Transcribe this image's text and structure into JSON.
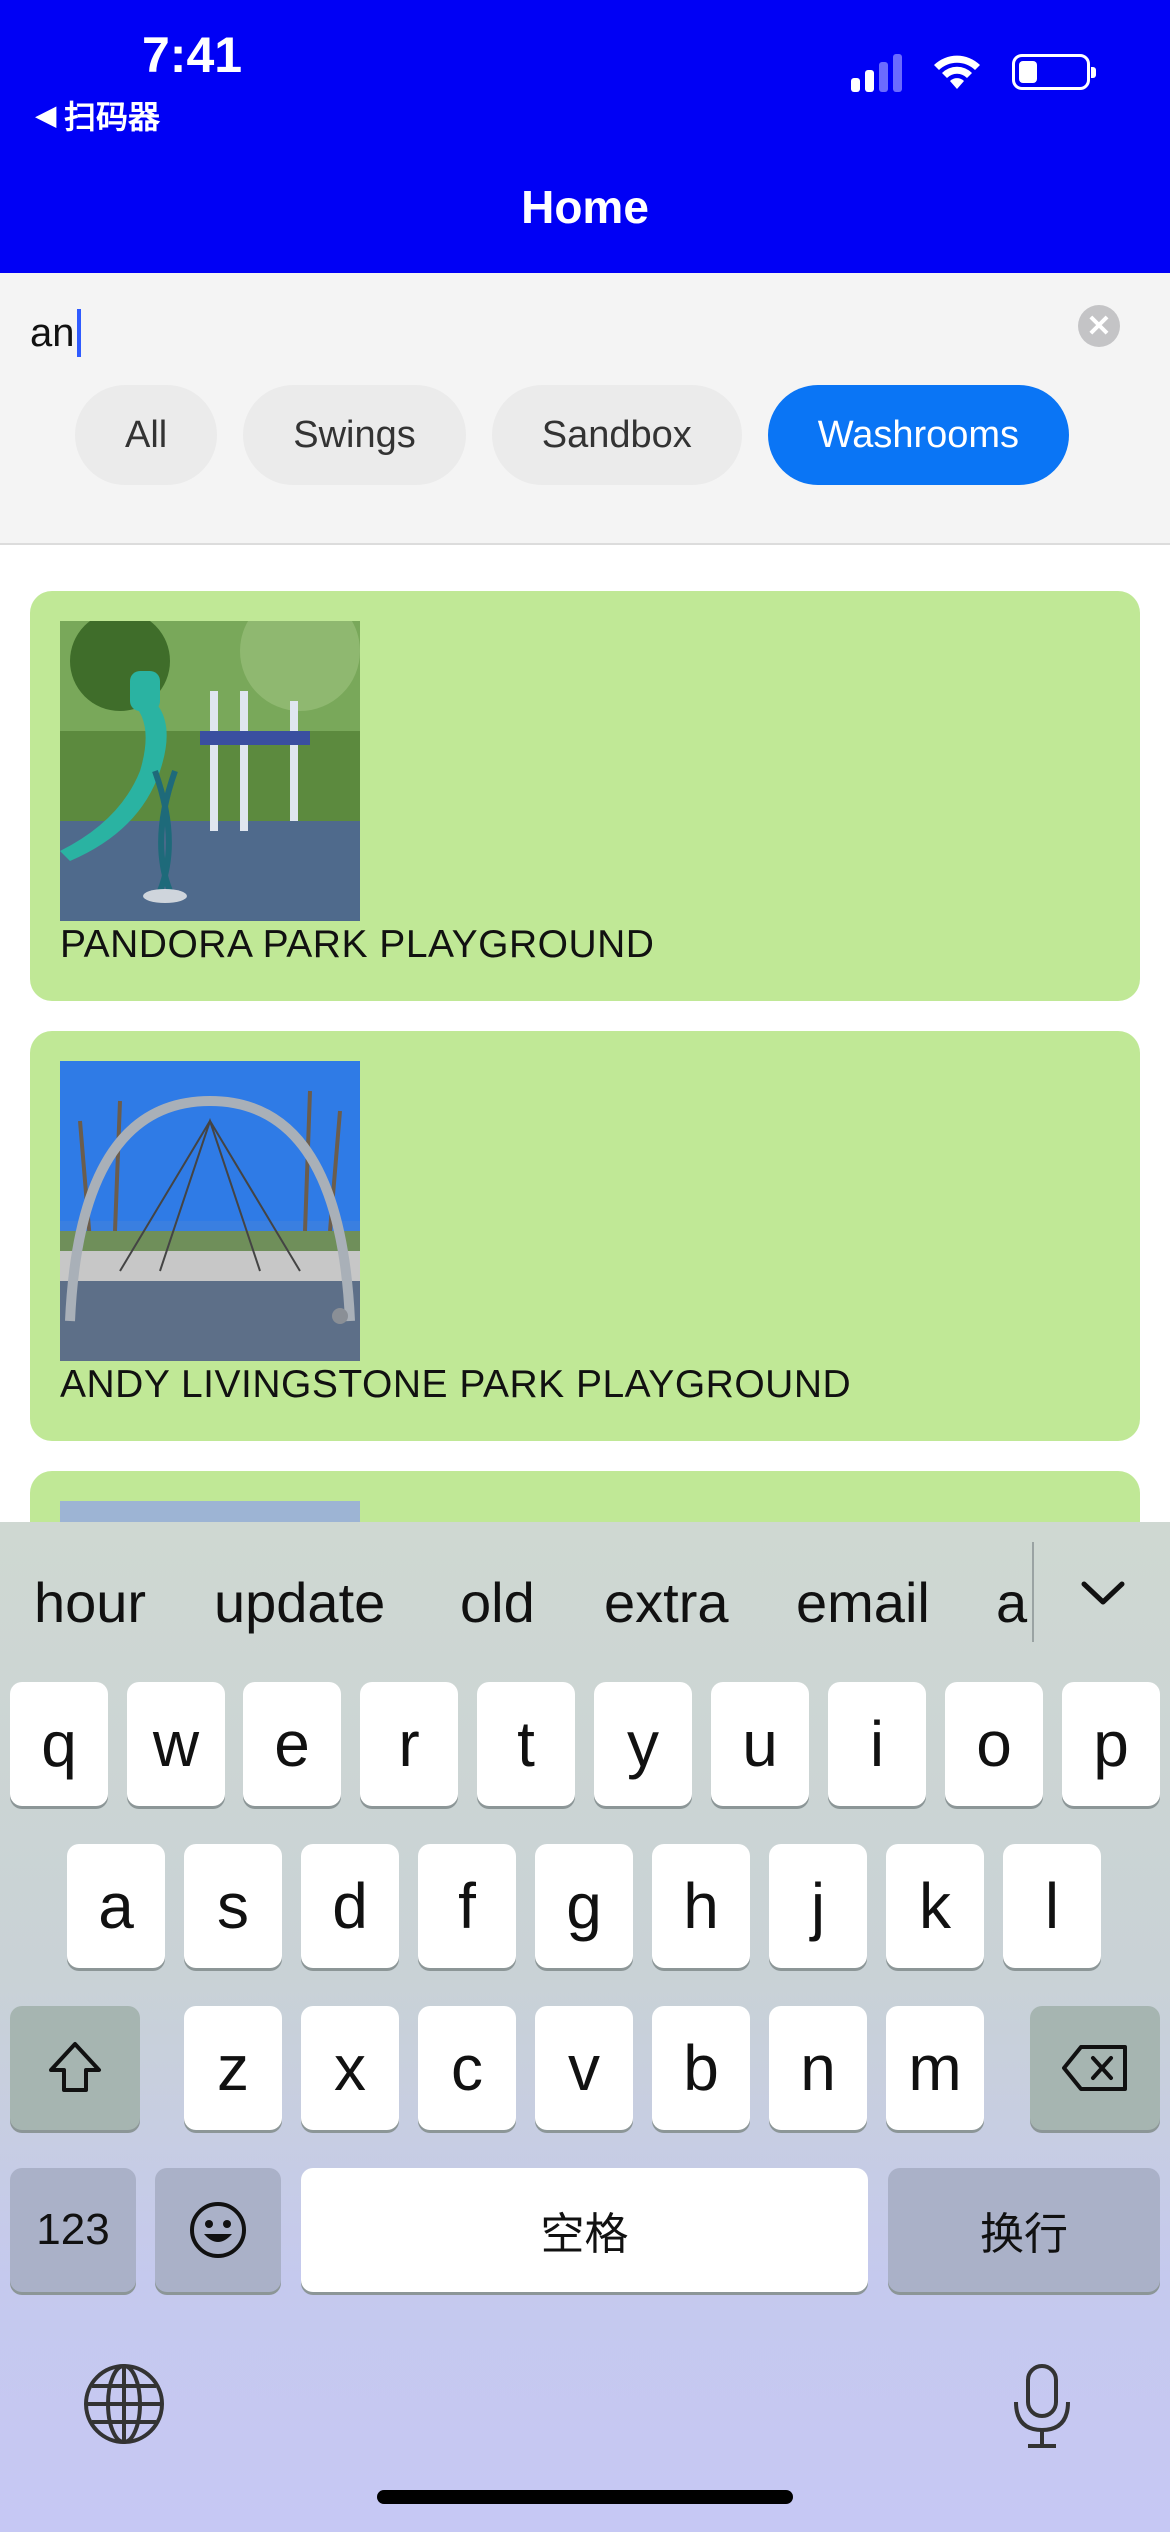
{
  "status_bar": {
    "time": "7:41",
    "back_app": "扫码器"
  },
  "header": {
    "title": "Home"
  },
  "search": {
    "value": "an",
    "clear_label": "✕"
  },
  "filters": {
    "chips": [
      "All",
      "Swings",
      "Sandbox",
      "Washrooms"
    ],
    "selected": "Washrooms"
  },
  "playgrounds": [
    {
      "name": "PANDORA PARK PLAYGROUND"
    },
    {
      "name": "ANDY LIVINGSTONE PARK PLAYGROUND"
    }
  ],
  "keyboard": {
    "suggestions": [
      "hour",
      "update",
      "old",
      "extra",
      "email",
      "ar"
    ],
    "row1": [
      "q",
      "w",
      "e",
      "r",
      "t",
      "y",
      "u",
      "i",
      "o",
      "p"
    ],
    "row2": [
      "a",
      "s",
      "d",
      "f",
      "g",
      "h",
      "j",
      "k",
      "l"
    ],
    "row3": [
      "z",
      "x",
      "c",
      "v",
      "b",
      "n",
      "m"
    ],
    "numbers_key": "123",
    "space_key": "空格",
    "return_key": "换行"
  },
  "colors": {
    "header": "#0000f5",
    "chip_active": "#0a75f5",
    "card": "#c0e896"
  }
}
